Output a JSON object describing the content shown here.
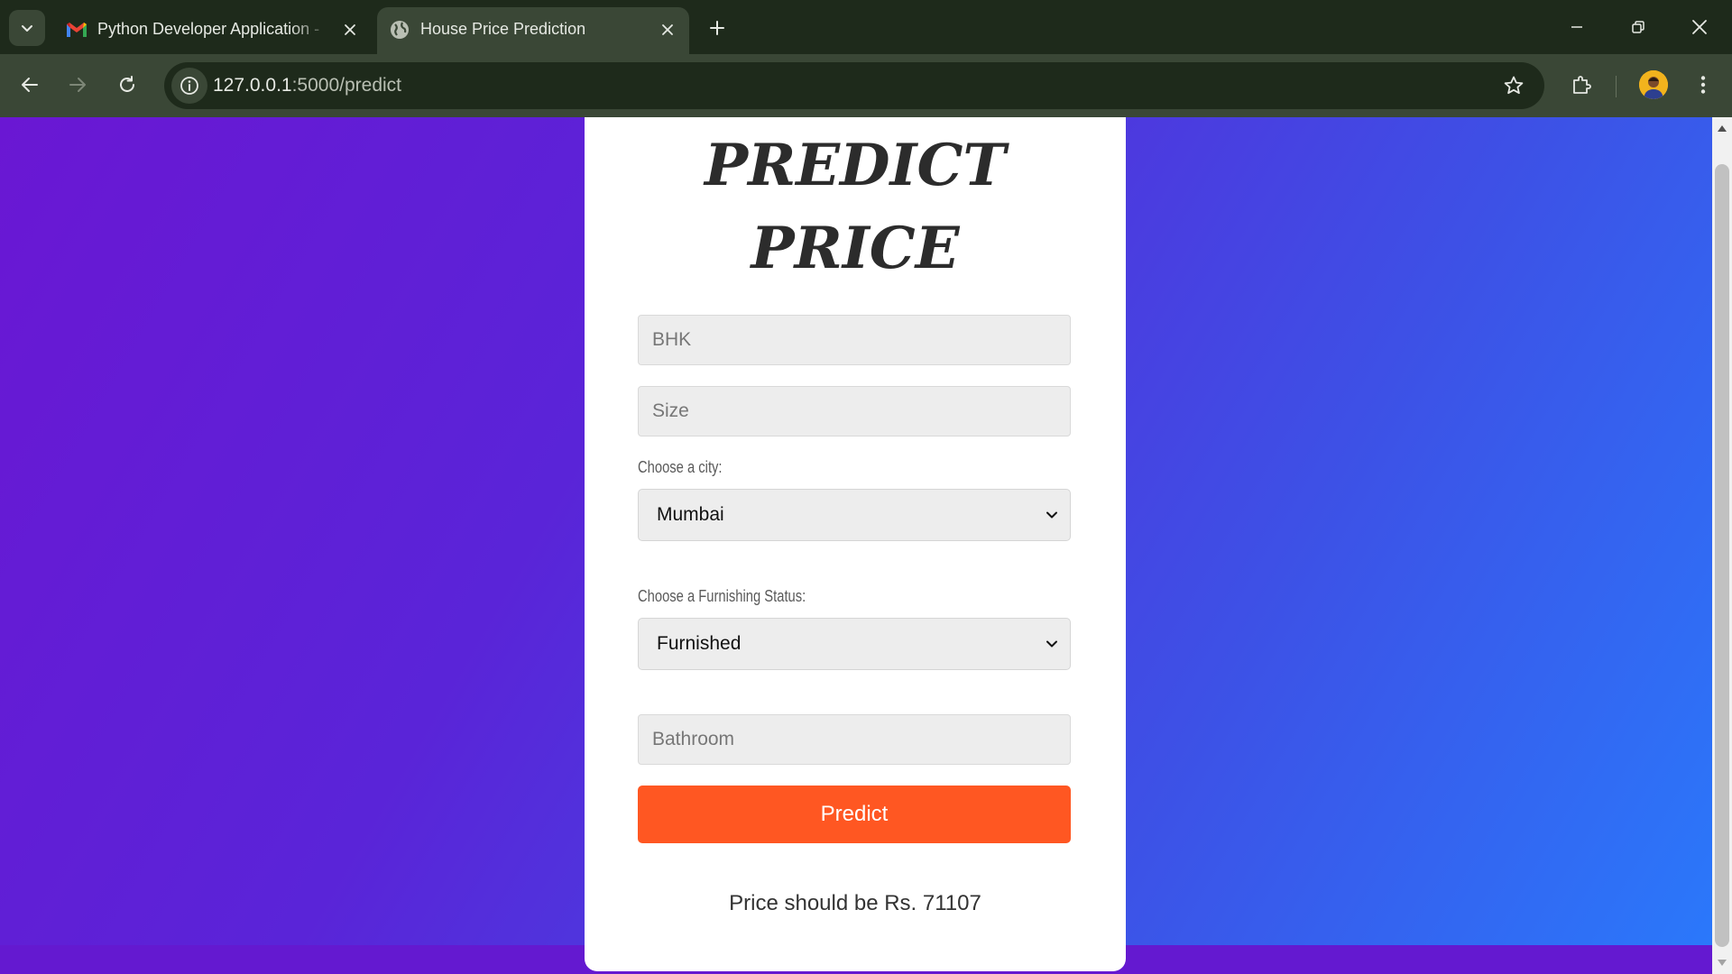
{
  "browser": {
    "tabs": [
      {
        "title": "Python Developer Application -",
        "icon": "gmail-icon",
        "active": false
      },
      {
        "title": "House Price Prediction",
        "icon": "globe-icon",
        "active": true
      }
    ],
    "address": {
      "host": "127.0.0.1",
      "path": ":5000/predict"
    },
    "colors": {
      "frame": "#1e2a1b",
      "toolbar": "#3a4736"
    }
  },
  "page": {
    "heading_line1": "PREDICT",
    "heading_line2": "PRICE",
    "fields": {
      "bhk_placeholder": "BHK",
      "size_placeholder": "Size",
      "bathroom_placeholder": "Bathroom"
    },
    "city": {
      "label": "Choose a city:",
      "selected": "Mumbai"
    },
    "furnishing": {
      "label": "Choose a Furnishing Status:",
      "selected": "Furnished"
    },
    "predict_label": "Predict",
    "result_text": "Price should be Rs. 71107",
    "colors": {
      "gradient_start": "#6a17d3",
      "gradient_end": "#2a79fb",
      "button": "#ff5722"
    }
  }
}
